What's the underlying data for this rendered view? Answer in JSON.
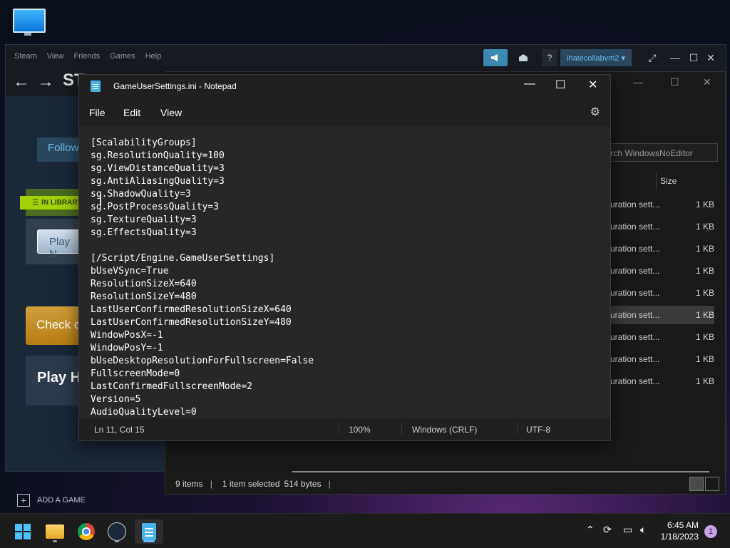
{
  "desktop": {
    "icon_name": "monitor-icon"
  },
  "steam": {
    "menu": [
      "Steam",
      "View",
      "Friends",
      "Games",
      "Help"
    ],
    "brand": "ST",
    "user": "ihatecollabvm2 ▾",
    "help": "?",
    "follow_label": "Follow",
    "in_library": "IN LIBRARY",
    "play_label": "Play N",
    "check_label": "Check o",
    "play_heading": "Play H",
    "add_game": "ADD A GAME"
  },
  "explorer": {
    "search_placeholder": "Search WindowsNoEditor",
    "size_header": "Size",
    "rows": [
      {
        "type": "uration sett...",
        "size": "1 KB",
        "selected": false
      },
      {
        "type": "uration sett...",
        "size": "1 KB",
        "selected": false
      },
      {
        "type": "uration sett...",
        "size": "1 KB",
        "selected": false
      },
      {
        "type": "uration sett...",
        "size": "1 KB",
        "selected": false
      },
      {
        "type": "uration sett...",
        "size": "1 KB",
        "selected": false
      },
      {
        "type": "uration sett...",
        "size": "1 KB",
        "selected": true
      },
      {
        "type": "uration sett...",
        "size": "1 KB",
        "selected": false
      },
      {
        "type": "uration sett...",
        "size": "1 KB",
        "selected": false
      },
      {
        "type": "uration sett...",
        "size": "1 KB",
        "selected": false
      }
    ],
    "status": {
      "items": "9 items",
      "selected": "1 item selected",
      "size": "514 bytes"
    }
  },
  "notepad": {
    "title": "GameUserSettings.ini - Notepad",
    "menu": {
      "file": "File",
      "edit": "Edit",
      "view": "View"
    },
    "lines": [
      "[ScalabilityGroups]",
      "sg.ResolutionQuality=100",
      "sg.ViewDistanceQuality=3",
      "sg.AntiAliasingQuality=3",
      "sg.ShadowQuality=3",
      "sg.PostProcessQuality=3",
      "sg.TextureQuality=3",
      "sg.EffectsQuality=3",
      "",
      "[/Script/Engine.GameUserSettings]",
      "bUseVSync=True",
      "ResolutionSizeX=640",
      "ResolutionSizeY=480",
      "LastUserConfirmedResolutionSizeX=640",
      "LastUserConfirmedResolutionSizeY=480",
      "WindowPosX=-1",
      "WindowPosY=-1",
      "bUseDesktopResolutionForFullscreen=False",
      "FullscreenMode=0",
      "LastConfirmedFullscreenMode=2",
      "Version=5",
      "AudioQualityLevel=0"
    ],
    "status": {
      "position": "Ln 11, Col 15",
      "zoom": "100%",
      "line_ending": "Windows (CRLF)",
      "encoding": "UTF-8"
    }
  },
  "taskbar": {
    "time": "6:45 AM",
    "date": "1/18/2023",
    "notifications": "1"
  }
}
